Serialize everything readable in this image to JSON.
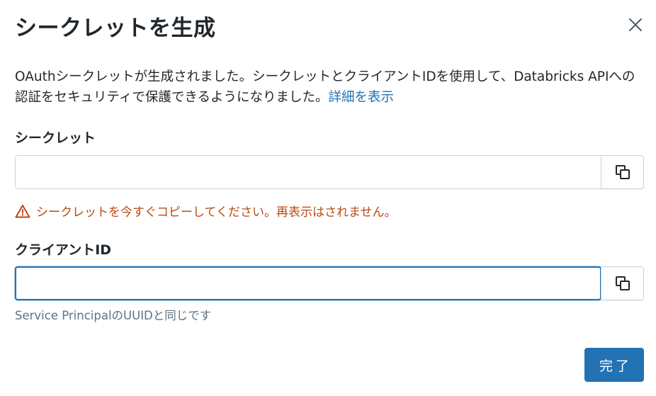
{
  "dialog": {
    "title": "シークレットを生成",
    "close_label": "×",
    "description": "OAuthシークレットが生成されました。シークレットとクライアントIDを使用して、Databricks APIへの認証をセキュリティで保護できるようになりました。",
    "learn_more": "詳細を表示"
  },
  "secret": {
    "label": "シークレット",
    "value": "",
    "warning": "シークレットを今すぐコピーしてください。再表示はされません。"
  },
  "client": {
    "label": "クライアントID",
    "value": "",
    "hint": "Service PrincipalのUUIDと同じです"
  },
  "footer": {
    "done_label": "完了"
  },
  "colors": {
    "primary": "#2272b4",
    "warning": "#b84a12",
    "text": "#1f272d",
    "muted": "#5f7281"
  }
}
